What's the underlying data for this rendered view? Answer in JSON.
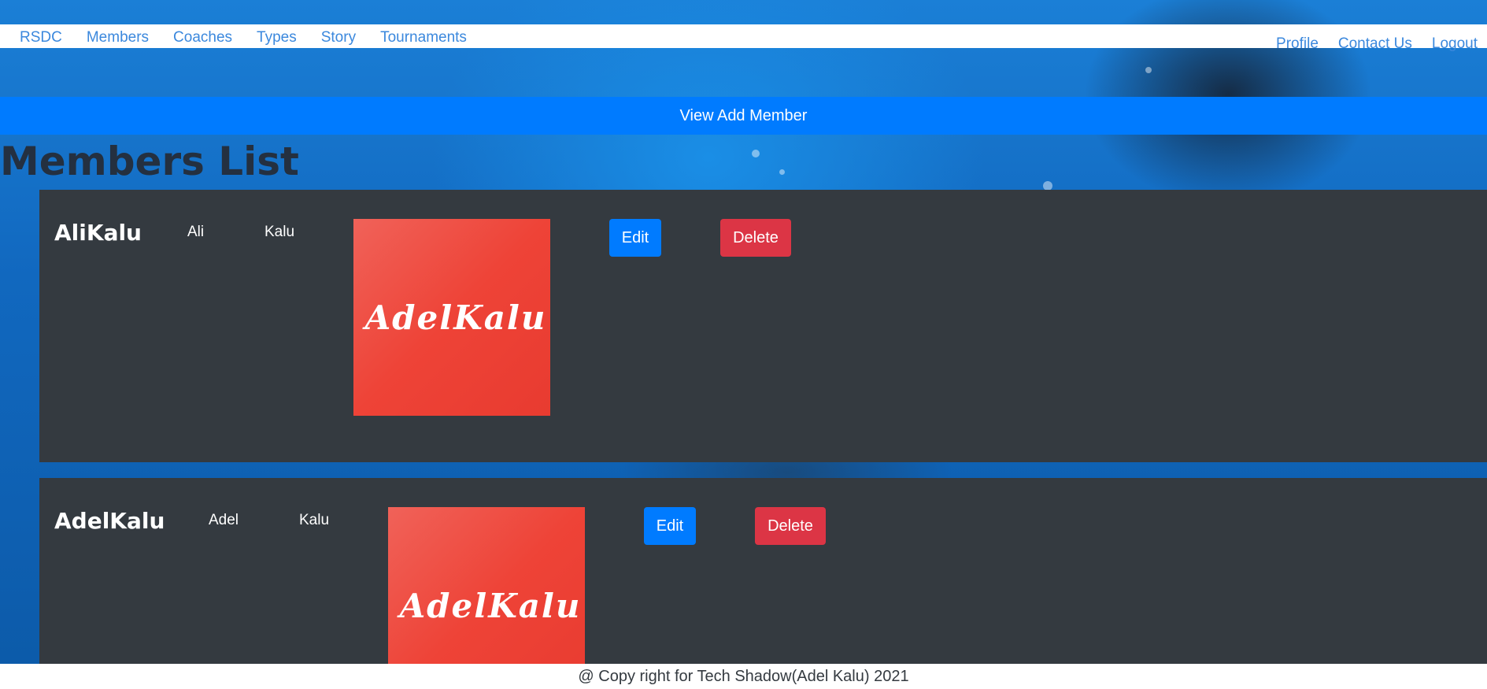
{
  "nav": {
    "brand": "RSDC",
    "left_links": [
      "Members",
      "Coaches",
      "Types",
      "Story",
      "Tournaments"
    ],
    "right_links": [
      "Profile",
      "Contact Us",
      "Logout"
    ]
  },
  "add_member_label": "View Add Member",
  "page_title": "Members List",
  "members": [
    {
      "full_name": "AliKalu",
      "first_name": "Ali",
      "last_name": "Kalu",
      "photo_text": "AdelKalu",
      "edit_label": "Edit",
      "delete_label": "Delete"
    },
    {
      "full_name": "AdelKalu",
      "first_name": "Adel",
      "last_name": "Kalu",
      "photo_text": "AdelKalu",
      "edit_label": "Edit",
      "delete_label": "Delete"
    }
  ],
  "footer": "@ Copy right for Tech Shadow(Adel Kalu) 2021",
  "colors": {
    "primary": "#007bff",
    "danger": "#dc3545",
    "card_bg": "#343a40",
    "photo_bg": "#ee4337",
    "nav_link": "#3b88dd"
  }
}
